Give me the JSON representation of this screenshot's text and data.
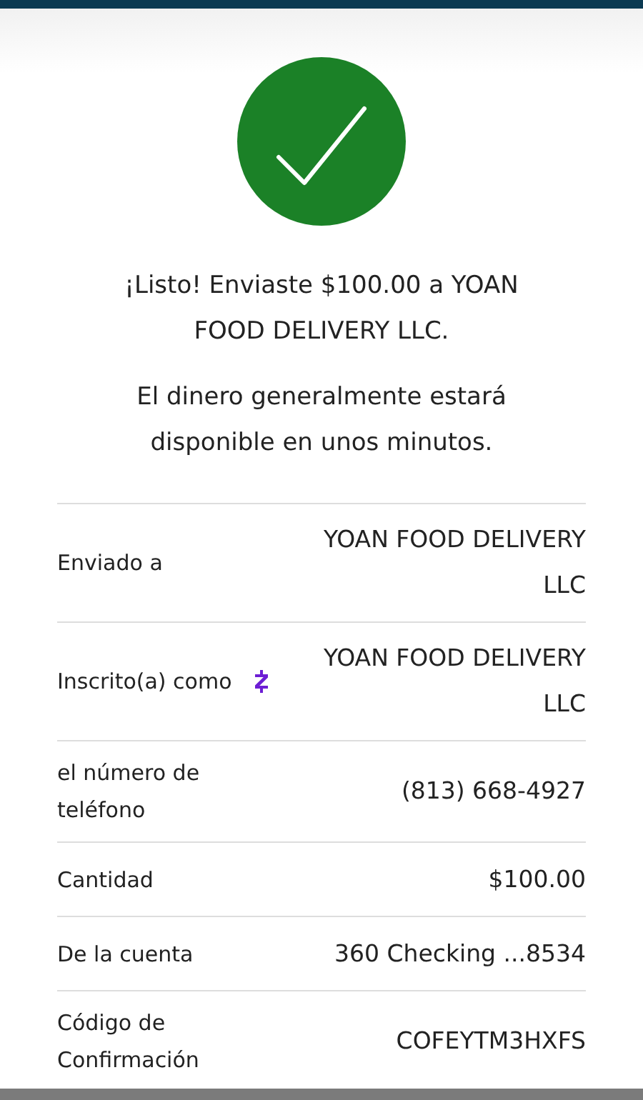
{
  "message": {
    "title": "¡Listo! Enviaste $100.00 a YOAN FOOD DELIVERY LLC.",
    "subtitle": "El dinero generalmente estará disponible en unos minutos."
  },
  "details": [
    {
      "kind": "plain",
      "label": "Enviado a",
      "value": "YOAN FOOD DELIVERY LLC"
    },
    {
      "kind": "zelle",
      "label": "Inscrito(a) como",
      "value": "YOAN FOOD DELIVERY LLC"
    },
    {
      "kind": "plain",
      "label": "el número de teléfono",
      "value": "(813) 668-4927"
    },
    {
      "kind": "plain",
      "label": "Cantidad",
      "value": "$100.00"
    },
    {
      "kind": "plain",
      "label": "De la cuenta",
      "value": "360 Checking ...8534"
    },
    {
      "kind": "plain",
      "label": "Código de Confirmación",
      "value": "COFEYTM3HXFS"
    }
  ]
}
